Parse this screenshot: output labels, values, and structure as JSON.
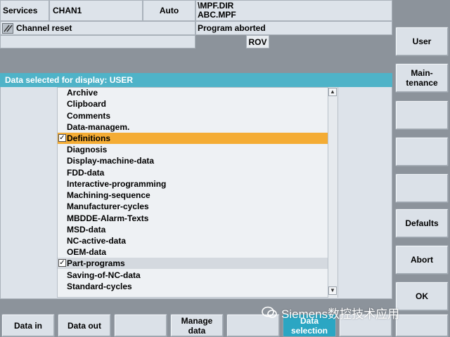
{
  "header": {
    "area": "Services",
    "channel": "CHAN1",
    "mode": "Auto",
    "path_line1": "\\MPF.DIR",
    "path_line2": "ABC.MPF",
    "channel_status": "Channel reset",
    "program_status": "Program aborted",
    "rov": "ROV"
  },
  "panel": {
    "title": "Data selected for display: USER",
    "items": [
      {
        "label": "Archive",
        "checked": false,
        "highlight": "none"
      },
      {
        "label": "Clipboard",
        "checked": false,
        "highlight": "none"
      },
      {
        "label": "Comments",
        "checked": false,
        "highlight": "none"
      },
      {
        "label": "Data-managem.",
        "checked": false,
        "highlight": "none"
      },
      {
        "label": "Definitions",
        "checked": true,
        "highlight": "focus"
      },
      {
        "label": "Diagnosis",
        "checked": false,
        "highlight": "none"
      },
      {
        "label": "Display-machine-data",
        "checked": false,
        "highlight": "none"
      },
      {
        "label": "FDD-data",
        "checked": false,
        "highlight": "none"
      },
      {
        "label": "Interactive-programming",
        "checked": false,
        "highlight": "none"
      },
      {
        "label": "Machining-sequence",
        "checked": false,
        "highlight": "none"
      },
      {
        "label": "Manufacturer-cycles",
        "checked": false,
        "highlight": "none"
      },
      {
        "label": "MBDDE-Alarm-Texts",
        "checked": false,
        "highlight": "none"
      },
      {
        "label": "MSD-data",
        "checked": false,
        "highlight": "none"
      },
      {
        "label": "NC-active-data",
        "checked": false,
        "highlight": "none"
      },
      {
        "label": "OEM-data",
        "checked": false,
        "highlight": "none"
      },
      {
        "label": "Part-programs",
        "checked": true,
        "highlight": "selected"
      },
      {
        "label": "Saving-of-NC-data",
        "checked": false,
        "highlight": "none"
      },
      {
        "label": "Standard-cycles",
        "checked": false,
        "highlight": "none"
      }
    ]
  },
  "softkeys_right": [
    "User",
    "Main-\ntenance",
    "",
    "",
    "",
    "Defaults",
    "Abort",
    "OK"
  ],
  "softkeys_bottom": [
    "Data in",
    "Data out",
    "",
    "Manage\ndata",
    "",
    "Data\nselection",
    "",
    ""
  ],
  "watermark": "Siemens数控技术应用",
  "colors": {
    "title_bar": "#4fb3c8",
    "focus_row": "#f4ac34",
    "selected_row": "#dde1e6",
    "active_softkey": "#2ba6c3"
  }
}
